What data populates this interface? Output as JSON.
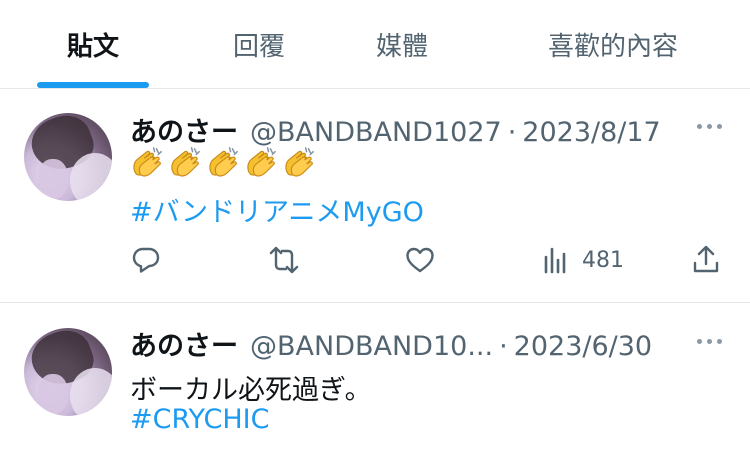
{
  "tabs": [
    {
      "label": "貼文",
      "active": true
    },
    {
      "label": "回覆",
      "active": false
    },
    {
      "label": "媒體",
      "active": false
    },
    {
      "label": "喜歡的內容",
      "active": false
    }
  ],
  "tweets": [
    {
      "name": "あのさー",
      "handle": "@BANDBAND1027",
      "separator": "·",
      "date": "2023/8/17",
      "emoji_count": 5,
      "hashtag": "#バンドリアニメMyGO",
      "views": "481"
    },
    {
      "name": "あのさー",
      "handle": "@BANDBAND10...",
      "separator": "·",
      "date": "2023/6/30",
      "text": "ボーカル必死過ぎ。",
      "hashtag": "#CRYCHIC"
    }
  ],
  "colors": {
    "accent": "#1d9bf0",
    "secondary_text": "#536471",
    "divider": "#e6e9ec"
  },
  "icons": [
    "reply-icon",
    "retweet-icon",
    "like-icon",
    "views-icon",
    "share-icon",
    "more-icon",
    "clapping-hands-emoji"
  ]
}
